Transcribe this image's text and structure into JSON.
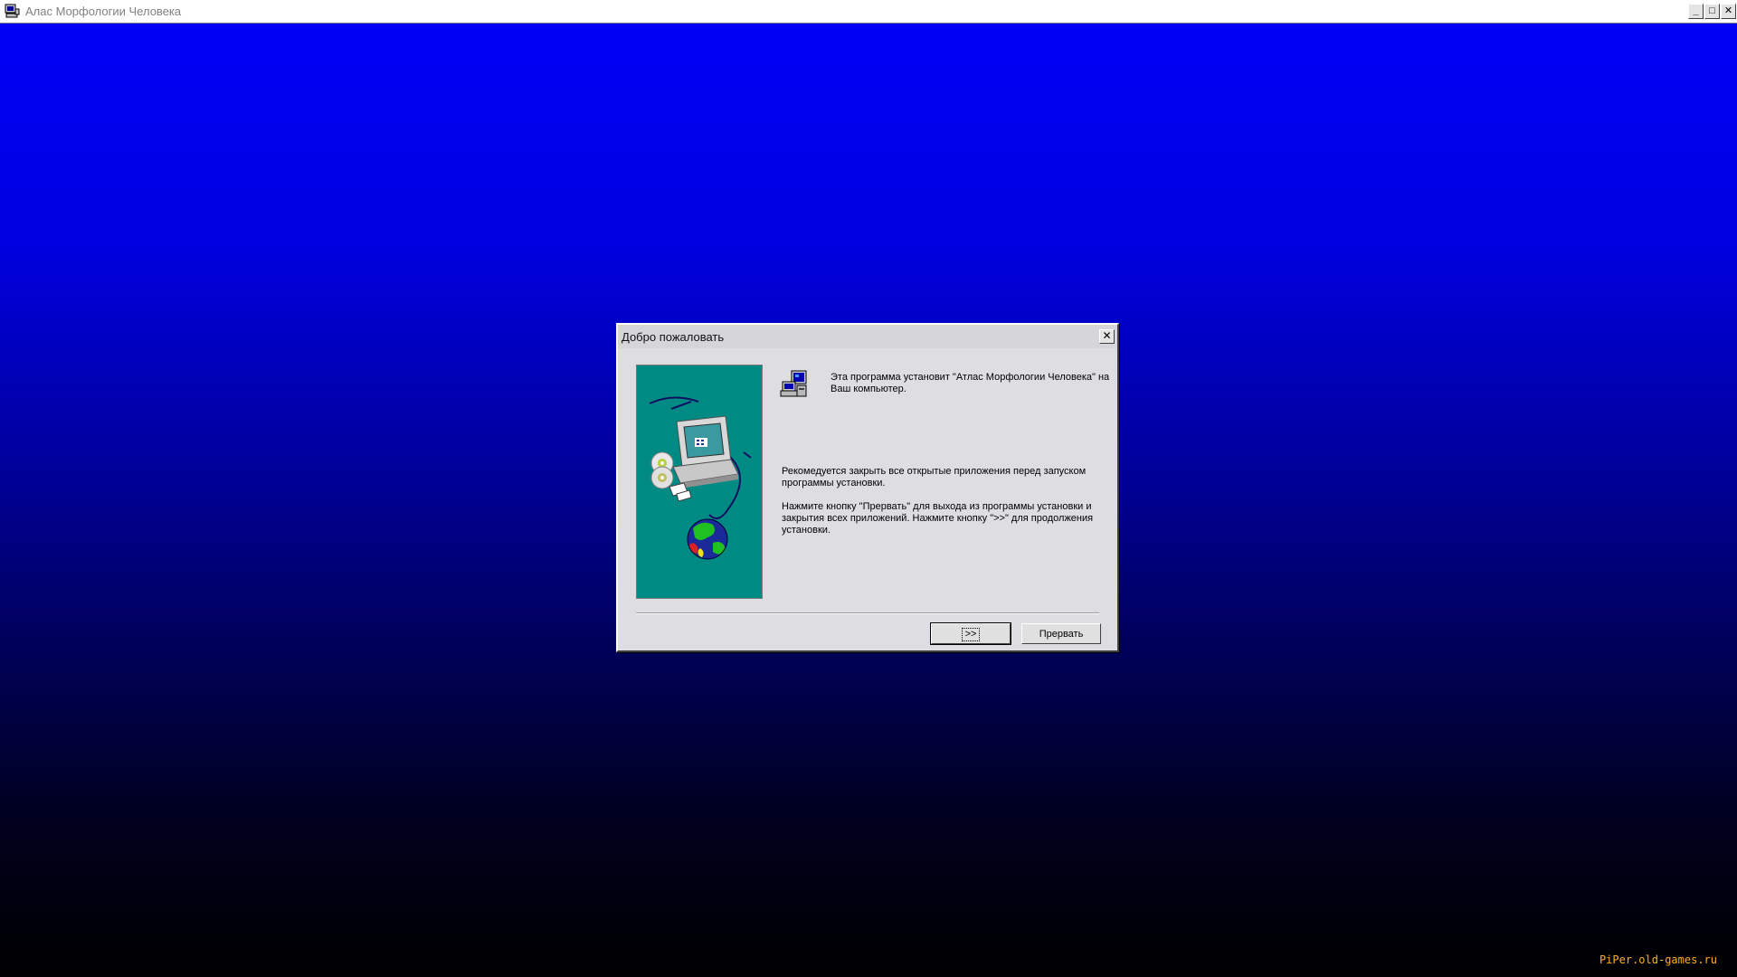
{
  "app_window": {
    "title": "Алас Морфологии Человека",
    "icon": "computer-setup-icon",
    "controls": {
      "minimize": "_",
      "maximize": "□",
      "close": "✕"
    }
  },
  "dialog": {
    "title": "Добро пожаловать",
    "close_label": "✕",
    "side_image": "computer-globe-illustration",
    "setup_icon": "setup-computer-icon",
    "intro_text": "Эта программа установит \"Атлас Морфологии Человека\" на Ваш компьютер.",
    "recommend_text": "Рекомедуется закрыть все открытые приложения перед запуском программы установки.",
    "instruct_text": "Нажмите кнопку \"Прервать\" для выхода из программы установки и закрытия всех  приложений.  Нажмите кнопку \">>\" для продолжения установки.",
    "buttons": {
      "next_label": ">>",
      "cancel_label": "Прервать"
    }
  },
  "watermark": "PiPer.old-games.ru",
  "colors": {
    "background_top": "#0000f8",
    "background_bottom": "#000000",
    "dialog_bg": "#dedde2",
    "side_image_bg": "#008a84",
    "watermark": "#ffb020"
  }
}
